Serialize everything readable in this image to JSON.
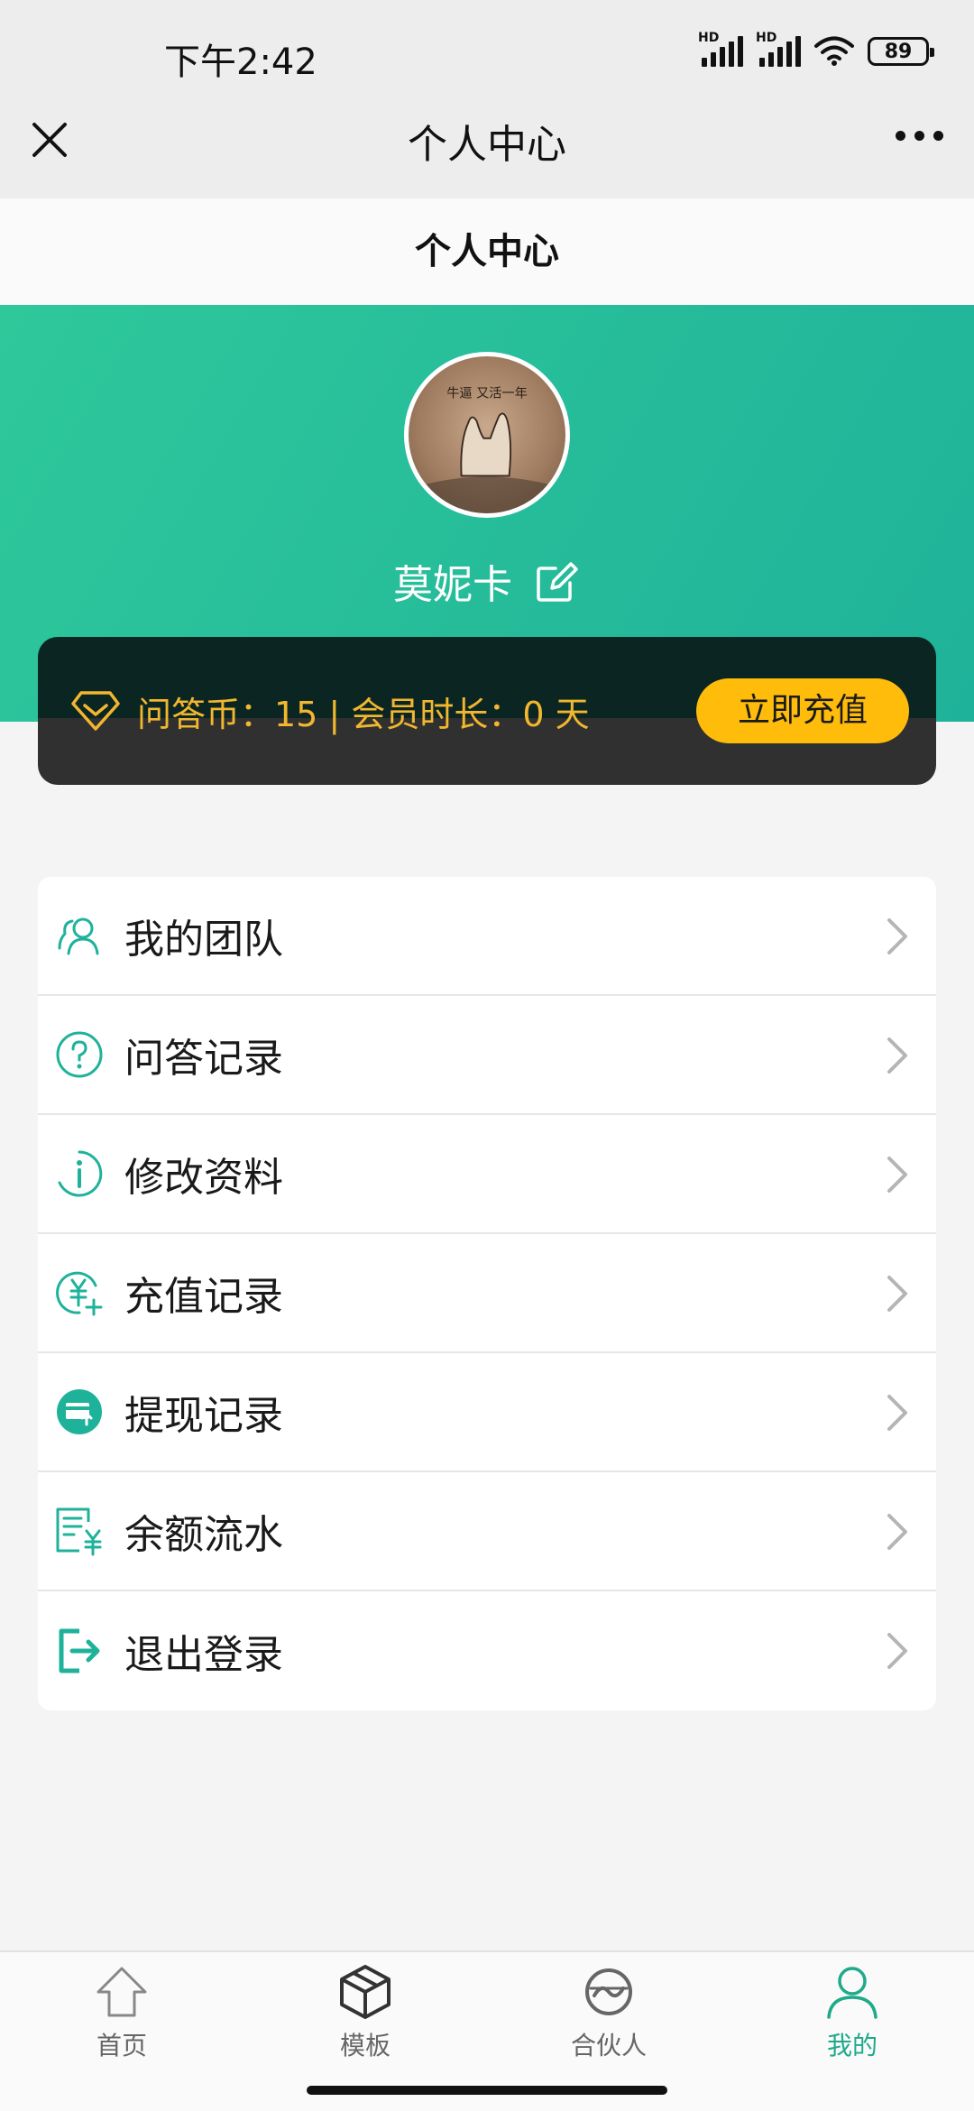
{
  "status_bar": {
    "time": "下午2:42",
    "battery": "89",
    "hd1": "HD",
    "hd2": "HD"
  },
  "nav": {
    "title": "个人中心"
  },
  "page": {
    "header": "个人中心"
  },
  "profile": {
    "username": "莫妮卡",
    "avatar_text": "牛逼 又活一年"
  },
  "member_card": {
    "text": "问答币：15 | 会员时长：0 天",
    "recharge_button": "立即充值",
    "accent_color": "#f2b62f"
  },
  "menu": [
    {
      "label": "我的团队",
      "icon": "team-icon"
    },
    {
      "label": "问答记录",
      "icon": "question-icon"
    },
    {
      "label": "修改资料",
      "icon": "info-icon"
    },
    {
      "label": "充值记录",
      "icon": "yuan-plus-icon"
    },
    {
      "label": "提现记录",
      "icon": "withdraw-icon"
    },
    {
      "label": "余额流水",
      "icon": "ledger-icon"
    },
    {
      "label": "退出登录",
      "icon": "logout-icon"
    }
  ],
  "tabbar": [
    {
      "label": "首页",
      "icon": "home-icon",
      "active": false
    },
    {
      "label": "模板",
      "icon": "cube-icon",
      "active": false
    },
    {
      "label": "合伙人",
      "icon": "partner-icon",
      "active": false
    },
    {
      "label": "我的",
      "icon": "person-icon",
      "active": true
    }
  ],
  "colors": {
    "brand": "#1fb29a",
    "recharge": "#ffbc0a"
  }
}
